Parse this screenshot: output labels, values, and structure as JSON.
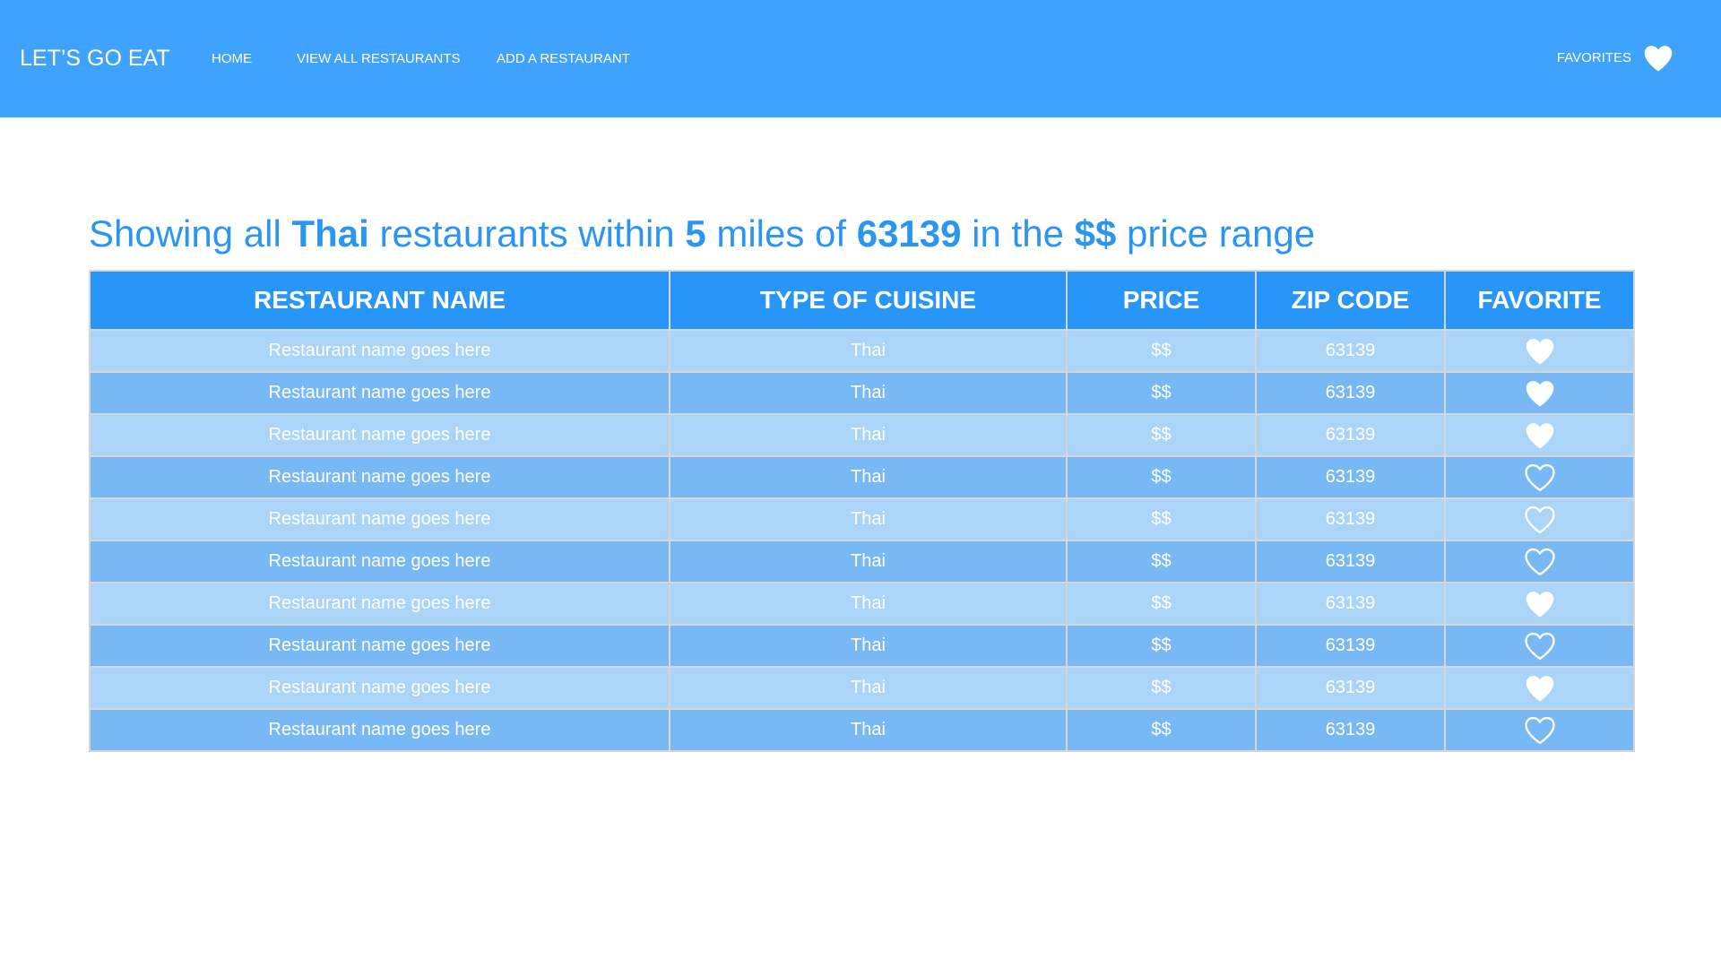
{
  "nav": {
    "brand": "LET’S GO EAT",
    "links": [
      "HOME",
      "VIEW ALL RESTAURANTS",
      "ADD A RESTAURANT"
    ],
    "favorites_label": "FAVORITES",
    "favorites_icon": "heart-filled-icon"
  },
  "headline": {
    "p1": "Showing all ",
    "cuisine": "Thai",
    "p2": " restaurants within ",
    "miles": "5",
    "p3": " miles of ",
    "zip": "63139",
    "p4": " in the ",
    "price": "$$",
    "p5": " price range"
  },
  "table": {
    "headers": [
      "RESTAURANT NAME",
      "TYPE OF CUISINE",
      "PRICE",
      "ZIP CODE",
      "FAVORITE"
    ],
    "rows": [
      {
        "name": "Restaurant name goes here",
        "cuisine": "Thai",
        "price": "$$",
        "zip": "63139",
        "favorite": true
      },
      {
        "name": "Restaurant name goes here",
        "cuisine": "Thai",
        "price": "$$",
        "zip": "63139",
        "favorite": true
      },
      {
        "name": "Restaurant name goes here",
        "cuisine": "Thai",
        "price": "$$",
        "zip": "63139",
        "favorite": true
      },
      {
        "name": "Restaurant name goes here",
        "cuisine": "Thai",
        "price": "$$",
        "zip": "63139",
        "favorite": false
      },
      {
        "name": "Restaurant name goes here",
        "cuisine": "Thai",
        "price": "$$",
        "zip": "63139",
        "favorite": false
      },
      {
        "name": "Restaurant name goes here",
        "cuisine": "Thai",
        "price": "$$",
        "zip": "63139",
        "favorite": false
      },
      {
        "name": "Restaurant name goes here",
        "cuisine": "Thai",
        "price": "$$",
        "zip": "63139",
        "favorite": true
      },
      {
        "name": "Restaurant name goes here",
        "cuisine": "Thai",
        "price": "$$",
        "zip": "63139",
        "favorite": false
      },
      {
        "name": "Restaurant name goes here",
        "cuisine": "Thai",
        "price": "$$",
        "zip": "63139",
        "favorite": true
      },
      {
        "name": "Restaurant name goes here",
        "cuisine": "Thai",
        "price": "$$",
        "zip": "63139",
        "favorite": false
      }
    ]
  },
  "colors": {
    "nav_bg": "#3fa3fd",
    "header_bg": "#2895f9",
    "row_light": "#aad4f8",
    "row_dark": "#78b9f5",
    "headline_text": "#2b95f2"
  }
}
